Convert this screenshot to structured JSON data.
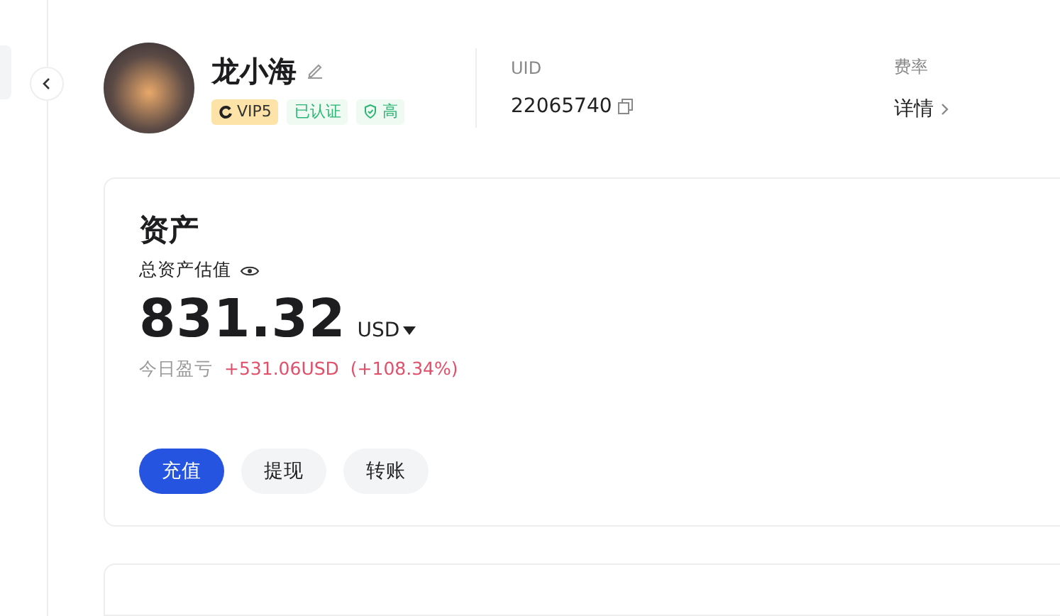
{
  "profile": {
    "name": "龙小海",
    "badges": [
      {
        "kind": "vip",
        "label": "VIP5"
      },
      {
        "kind": "verified",
        "label": "已认证"
      },
      {
        "kind": "security",
        "label": "高"
      }
    ]
  },
  "info": [
    {
      "label": "UID",
      "value": "22065740",
      "kind": "copy"
    },
    {
      "label": "费率",
      "value": "详情",
      "kind": "link"
    }
  ],
  "assets": {
    "title": "资产",
    "subtitle": "总资产估值",
    "amount": "831.32",
    "currency": "USD",
    "pnl_label": "今日盈亏",
    "pnl_value": "+531.06USD",
    "pnl_percent": "(+108.34%)",
    "buttons": [
      {
        "label": "充值",
        "primary": true
      },
      {
        "label": "提现",
        "primary": false
      },
      {
        "label": "转账",
        "primary": false
      }
    ]
  }
}
